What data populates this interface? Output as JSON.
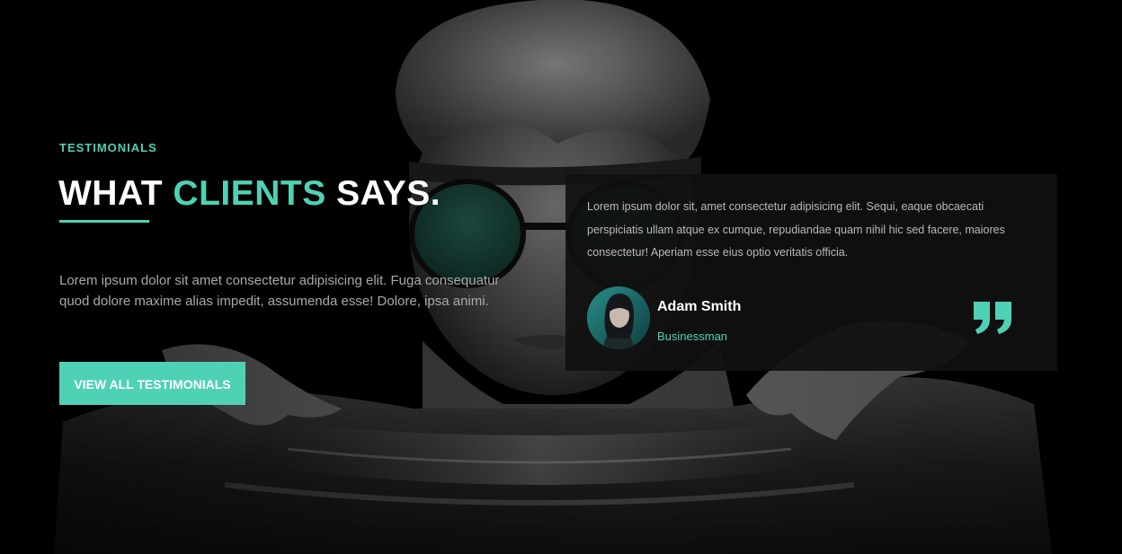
{
  "section": {
    "eyebrow": "TESTIMONIALS",
    "title_part1": "WHAT ",
    "title_accent": "CLIENTS",
    "title_part2": " SAYS.",
    "intro": "Lorem ipsum dolor sit amet consectetur adipisicing elit. Fuga consequatur quod dolore maxime alias impedit, assumenda esse! Dolore, ipsa animi.",
    "cta_label": "VIEW ALL TESTIMONIALS"
  },
  "testimonial": {
    "text": "Lorem ipsum dolor sit, amet consectetur adipisicing elit. Sequi, eaque obcaecati perspiciatis ullam atque ex cumque, repudiandae quam nihil hic sed facere, maiores consectetur! Aperiam esse eius optio veritatis officia.",
    "author_name": "Adam Smith",
    "author_role": "Businessman",
    "quote_icon": "quote-icon"
  },
  "colors": {
    "accent": "#4fd1b5",
    "background": "#000000",
    "card": "#101010",
    "text_muted": "#a9a9a9"
  }
}
